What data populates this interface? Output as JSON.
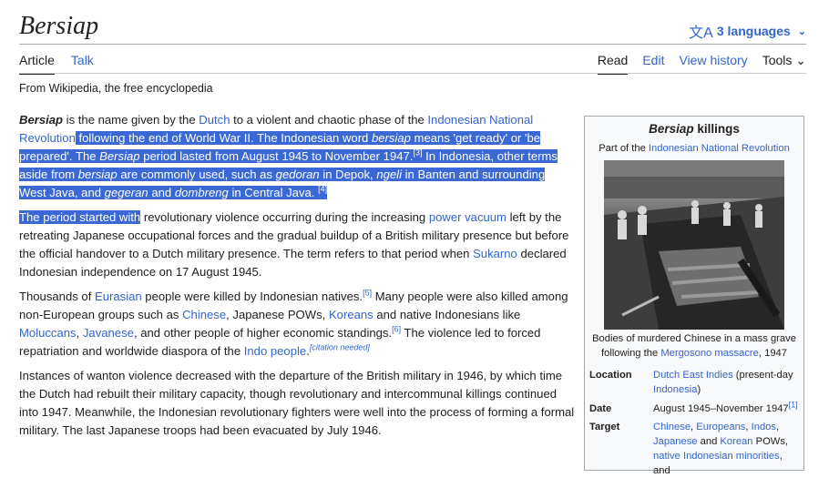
{
  "page": {
    "title": "Bersiap",
    "languages": "3 languages",
    "tagline": "From Wikipedia, the free encyclopedia"
  },
  "tabs": {
    "article": "Article",
    "talk": "Talk",
    "read": "Read",
    "edit": "Edit",
    "history": "View history",
    "tools": "Tools"
  },
  "p1": {
    "t01": "Bersiap",
    "t02": " is the name given by the ",
    "t03": "Dutch",
    "t04": " to a violent and chaotic phase of the ",
    "t05": "Indonesian National Revolution",
    "t06": " following the end of World War II. The Indonesian word ",
    "t07": "bersiap",
    "t08": " means 'get ready' or 'be prepared'. The ",
    "t09": "Bersiap",
    "t10": " period lasted from August 1945 to November 1947.",
    "t11": "[3]",
    "t12": " In Indonesia, other terms aside from ",
    "t13": "bersiap",
    "t14": " are commonly used, such as ",
    "t15": "gedoran",
    "t16": " in Depok, ",
    "t17": "ngeli",
    "t18": " in Banten and surrounding West Java, and ",
    "t19": "gegeran",
    "t20": " and ",
    "t21": "dombreng",
    "t22": " in Central Java. ",
    "t23": "[4]"
  },
  "p2": {
    "t01": "The period started with",
    "t02": " revolutionary violence occurring during the increasing ",
    "t03": "power vacuum",
    "t04": " left by the retreating Japanese occupational forces and the gradual buildup of a British military presence but before the official handover to a Dutch military presence. The term refers to that period when ",
    "t05": "Sukarno",
    "t06": " declared Indonesian independence on 17 August 1945."
  },
  "p3": {
    "t01": "Thousands of ",
    "t02": "Eurasian",
    "t03": " people were killed by Indonesian natives.",
    "t04": "[5]",
    "t05": " Many people were also killed among non-European groups such as ",
    "t06": "Chinese",
    "t07": ", Japanese POWs, ",
    "t08": "Koreans",
    "t09": " and native Indonesians like ",
    "t10": "Moluccans",
    "t11": ", ",
    "t12": "Javanese",
    "t13": ", and other people of higher economic standings.",
    "t14": "[6]",
    "t15": " The violence led to forced repatriation and worldwide diaspora of the ",
    "t16": "Indo people",
    "t17": ".",
    "t18": "[citation needed]"
  },
  "p4": {
    "t01": "Instances of wanton violence decreased with the departure of the British military in 1946, by which time the Dutch had rebuilt their military capacity, though revolutionary and intercommunal killings continued into 1947. Meanwhile, the Indonesian revolutionary fighters were well into the process of forming a formal military. The last Japanese troops had been evacuated by July 1946."
  },
  "infobox": {
    "title_italic": "Bersiap",
    "title_rest": " killings",
    "part_of": "Part of the ",
    "part_link": "Indonesian National Revolution",
    "caption_1": "Bodies of murdered Chinese in a mass grave following the ",
    "caption_link": "Mergosono massacre",
    "caption_2": ", 1947",
    "location_label": "Location",
    "location_link": "Dutch East Indies",
    "location_rest": " (present-day ",
    "location_link2": "Indonesia",
    "location_end": ")",
    "date_label": "Date",
    "date_value": "August 1945–November 1947",
    "date_ref": "[1]",
    "target_label": "Target",
    "target_l1": "Chinese",
    "target_s1": ", ",
    "target_l2": "Europeans",
    "target_s2": ", ",
    "target_l3": "Indos",
    "target_s3": ", ",
    "target_l4": "Japanese",
    "target_s4": " and ",
    "target_l5": "Korean",
    "target_s5": " POWs, ",
    "target_l6": "native Indonesian minorities",
    "target_s6": ", and"
  }
}
